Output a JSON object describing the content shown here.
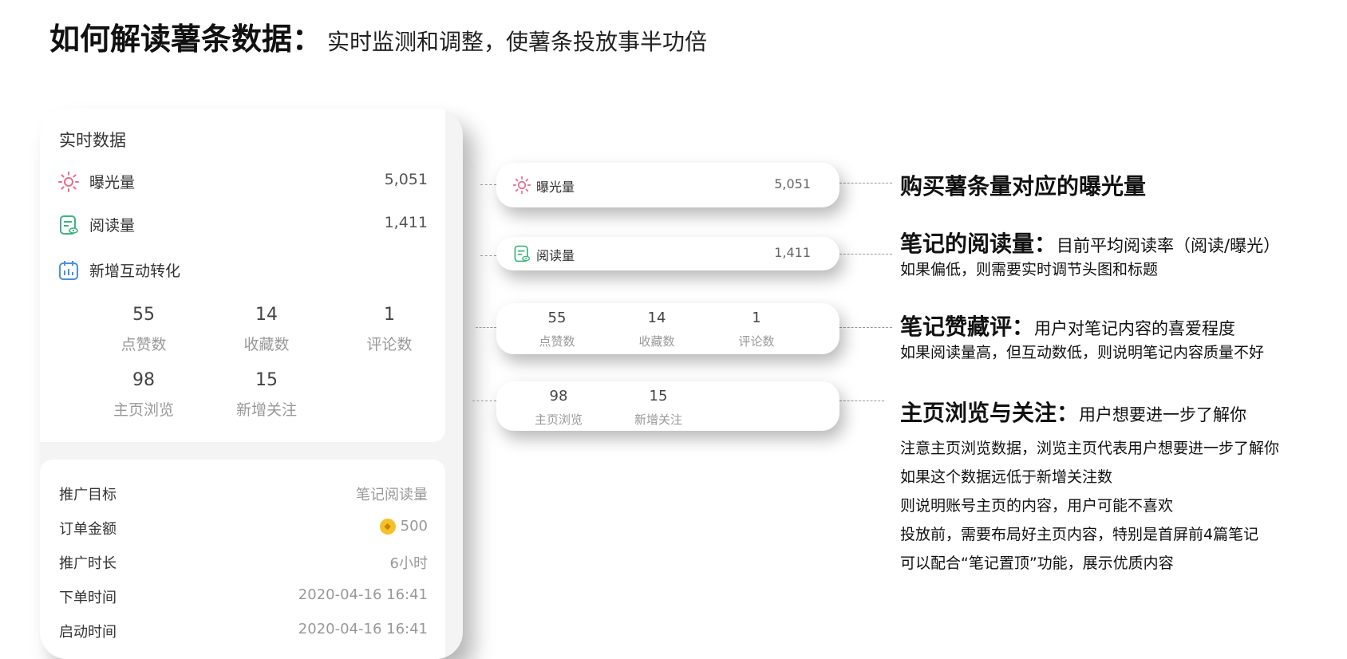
{
  "title": {
    "main": "如何解读薯条数据：",
    "sub": "实时监测和调整，使薯条投放事半功倍"
  },
  "phone": {
    "card_title": "实时数据",
    "exposure": {
      "label": "曝光量",
      "value": "5,051"
    },
    "reads": {
      "label": "阅读量",
      "value": "1,411"
    },
    "interaction": {
      "label": "新增互动转化"
    },
    "stats": [
      {
        "num": "55",
        "cap": "点赞数"
      },
      {
        "num": "14",
        "cap": "收藏数"
      },
      {
        "num": "1",
        "cap": "评论数"
      },
      {
        "num": "98",
        "cap": "主页浏览"
      },
      {
        "num": "15",
        "cap": "新增关注"
      }
    ],
    "info": [
      {
        "k": "推广目标",
        "v": "笔记阅读量"
      },
      {
        "k": "订单金额",
        "v": "500"
      },
      {
        "k": "推广时长",
        "v": "6小时"
      },
      {
        "k": "下单时间",
        "v": "2020-04-16 16:41"
      },
      {
        "k": "启动时间",
        "v": "2020-04-16 16:41"
      }
    ]
  },
  "pills": {
    "exposure": {
      "label": "曝光量",
      "value": "5,051"
    },
    "reads": {
      "label": "阅读量",
      "value": "1,411"
    },
    "row1": [
      {
        "num": "55",
        "cap": "点赞数"
      },
      {
        "num": "14",
        "cap": "收藏数"
      },
      {
        "num": "1",
        "cap": "评论数"
      }
    ],
    "row2": [
      {
        "num": "98",
        "cap": "主页浏览"
      },
      {
        "num": "15",
        "cap": "新增关注"
      }
    ]
  },
  "notes": {
    "n1": {
      "heading": "购买薯条量对应的曝光量"
    },
    "n2": {
      "heading": "笔记的阅读量：",
      "sub": "目前平均阅读率（阅读/曝光）",
      "line1": "如果偏低，则需要实时调节头图和标题"
    },
    "n3": {
      "heading": "笔记赞藏评：",
      "sub": "用户对笔记内容的喜爱程度",
      "line1": "如果阅读量高，但互动数低，则说明笔记内容质量不好"
    },
    "n4": {
      "heading": "主页浏览与关注：",
      "sub": "用户想要进一步了解你",
      "lines": [
        "注意主页浏览数据，浏览主页代表用户想要进一步了解你",
        "如果这个数据远低于新增关注数",
        "则说明账号主页的内容，用户可能不喜欢",
        "投放前，需要布局好主页内容，特别是首屏前4篇笔记",
        "可以配合“笔记置顶”功能，展示优质内容"
      ]
    }
  },
  "colors": {
    "sun_icon": "#e86a8a",
    "read_icon": "#3fb37f",
    "calendar_icon": "#4a90d9",
    "coin": "#f4c12b"
  }
}
